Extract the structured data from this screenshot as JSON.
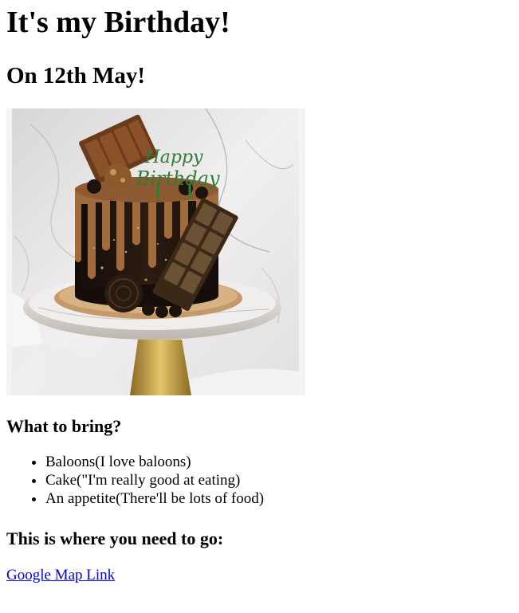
{
  "heading": "It's my Birthday!",
  "subheading": "On 12th May!",
  "image": {
    "alt": "Chocolate drip birthday cake with Happy Birthday topper",
    "topper_text_line1": "Happy",
    "topper_text_line2": "Birthday",
    "colors": {
      "marble": "#e9e6e6",
      "cake": "#2a1a12",
      "drip": "#b07a4e",
      "board": "#c49a6b",
      "stand_gold": "#c8a24a",
      "topper_green": "#2f7d3a"
    }
  },
  "bring_section": {
    "title": "What to bring?",
    "items": [
      "Baloons(I love baloons)",
      "Cake(\"I'm really good at eating)",
      "An appetite(There'll be lots of food)"
    ]
  },
  "directions": {
    "title": "This is where you need to go:",
    "link_label": "Google Map Link"
  },
  "colors": {
    "link": "#0000ee"
  }
}
